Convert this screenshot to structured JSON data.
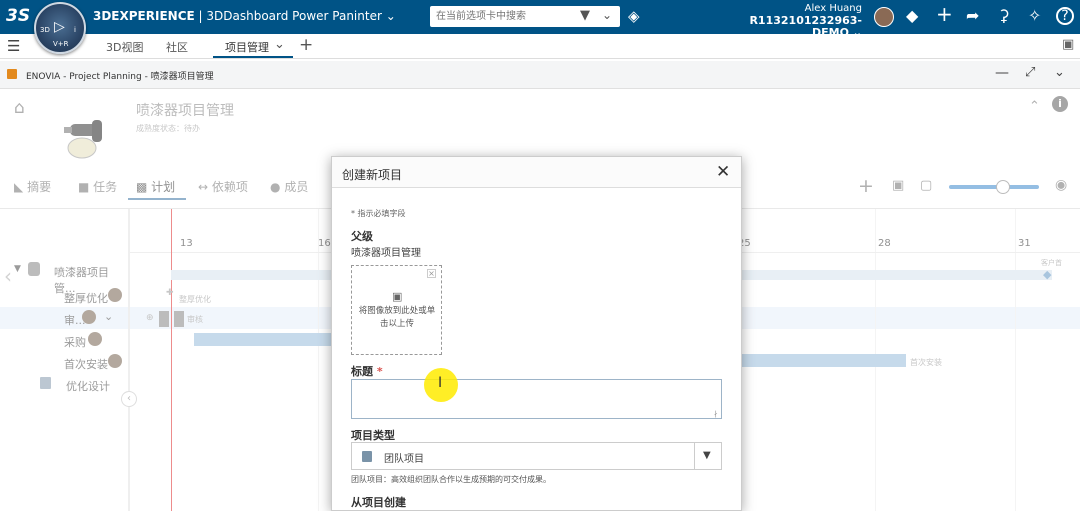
{
  "topbar": {
    "compass_labels": [
      "3D",
      "V+R",
      "i"
    ],
    "brand_bold": "3DEXPERIENCE",
    "brand_rest": " | 3DDashboard Power Paninter",
    "search_placeholder": "在当前选项卡中搜索",
    "user_name": "Alex Huang",
    "tenant": "R1132101232963-DEMO",
    "bg_color": "#005386"
  },
  "tabs": {
    "items": [
      "3D视图",
      "社区",
      "项目管理"
    ],
    "active": "项目管理"
  },
  "widget": {
    "title": "ENOVIA - Project Planning - 喷漆器项目管理"
  },
  "project": {
    "title": "喷漆器项目管理",
    "maturity": "成熟度状态：待办"
  },
  "subtabs": [
    "摘要",
    "任务",
    "计划",
    "依赖项",
    "成员"
  ],
  "gantt": {
    "dates": [
      "13",
      "16",
      "25",
      "28",
      "31"
    ],
    "tasks": [
      {
        "label": "喷漆器项目管..."
      },
      {
        "label": "整厚优化"
      },
      {
        "label": "审..."
      },
      {
        "label": "采购"
      },
      {
        "label": "首次安装"
      },
      {
        "label": "优化设计"
      }
    ],
    "bar_labels": {
      "customer": "客户首",
      "zheng": "整厚优化",
      "shen": "审核",
      "first_install": "首次安装"
    }
  },
  "dialog": {
    "title": "创建新项目",
    "required_note": "* 指示必填字段",
    "parent_label": "父级",
    "parent_value": "喷漆器项目管理",
    "drop_text": "将图像放到此处或单击以上传",
    "title_label": "标题",
    "required_star": "*",
    "type_label": "项目类型",
    "type_value": "团队项目",
    "type_desc": "团队项目：高效组织团队合作以生成预期的可交付成果。",
    "from_label": "从项目创建"
  }
}
